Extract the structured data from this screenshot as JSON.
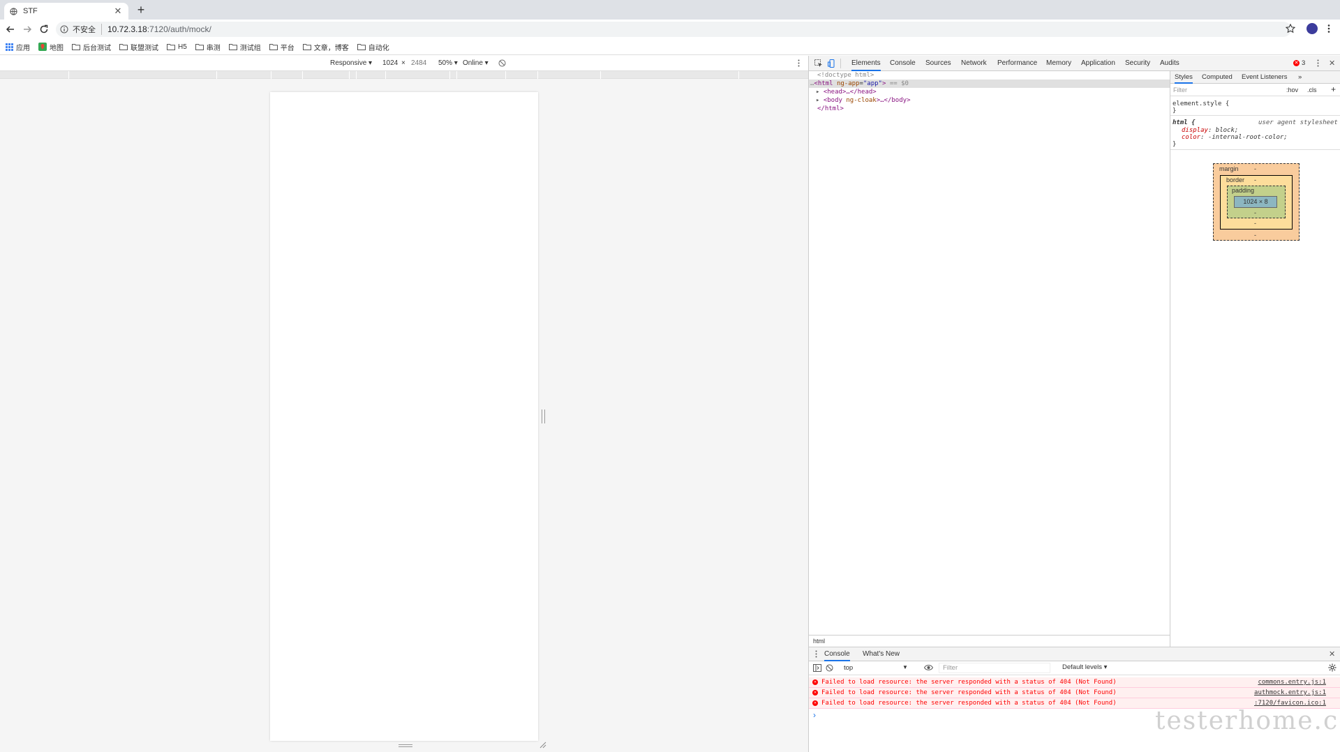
{
  "browser": {
    "tab_title": "STF",
    "new_tab": "+",
    "insecure_label": "不安全",
    "url_host": "10.72.3.18",
    "url_path": ":7120/auth/mock/",
    "bookmarks": [
      "应用",
      "地图",
      "后台测试",
      "联盟测试",
      "H5",
      "串测",
      "测试组",
      "平台",
      "文章，博客",
      "自动化"
    ]
  },
  "device_toolbar": {
    "mode": "Responsive ▾",
    "width": "1024",
    "times": "×",
    "height": "2484",
    "zoom": "50% ▾",
    "network": "Online ▾"
  },
  "devtools": {
    "tabs": [
      "Elements",
      "Console",
      "Sources",
      "Network",
      "Performance",
      "Memory",
      "Application",
      "Security",
      "Audits"
    ],
    "active_tab": "Elements",
    "error_count": "3",
    "dom": {
      "doctype": "<!doctype html>",
      "html_open": "<html",
      "html_attr_name": "ng-app",
      "html_attr_value": "\"app\"",
      "html_close_bracket": ">",
      "html_selected": "== $0",
      "head": "<head>…</head>",
      "body_open": "<body",
      "body_attr_name": "ng-cloak",
      "body_rest": ">…</body>",
      "html_end": "</html>"
    },
    "breadcrumb": "html",
    "styles_tabs": [
      "Styles",
      "Computed",
      "Event Listeners",
      "»"
    ],
    "filter_placeholder": "Filter",
    "hov": ":hov",
    "cls": ".cls",
    "element_style": "element.style {",
    "brace_close": "}",
    "rule_selector": "html {",
    "rule_origin": "user agent stylesheet",
    "prop1_name": "display",
    "prop1_value": "block;",
    "prop2_name": "color",
    "prop2_value": "-internal-root-color;",
    "box_model": {
      "margin": "margin",
      "border": "border",
      "padding": "padding",
      "content": "1024 × 8",
      "dash": "-"
    }
  },
  "console": {
    "drawer_tabs": [
      "Console",
      "What's New"
    ],
    "context": "top",
    "filter_placeholder": "Filter",
    "levels": "Default levels ▾",
    "messages": [
      {
        "text": "Failed to load resource: the server responded with a status of 404 (Not Found)",
        "source": "commons.entry.js:1"
      },
      {
        "text": "Failed to load resource: the server responded with a status of 404 (Not Found)",
        "source": "authmock.entry.js:1"
      },
      {
        "text": "Failed to load resource: the server responded with a status of 404 (Not Found)",
        "source": ":7120/favicon.ico:1"
      }
    ],
    "prompt": "›"
  },
  "watermark": "testerhome.com",
  "colors": {
    "accent": "#1a73e8",
    "error": "#ff0000",
    "avatar": "#3c3c9c"
  }
}
